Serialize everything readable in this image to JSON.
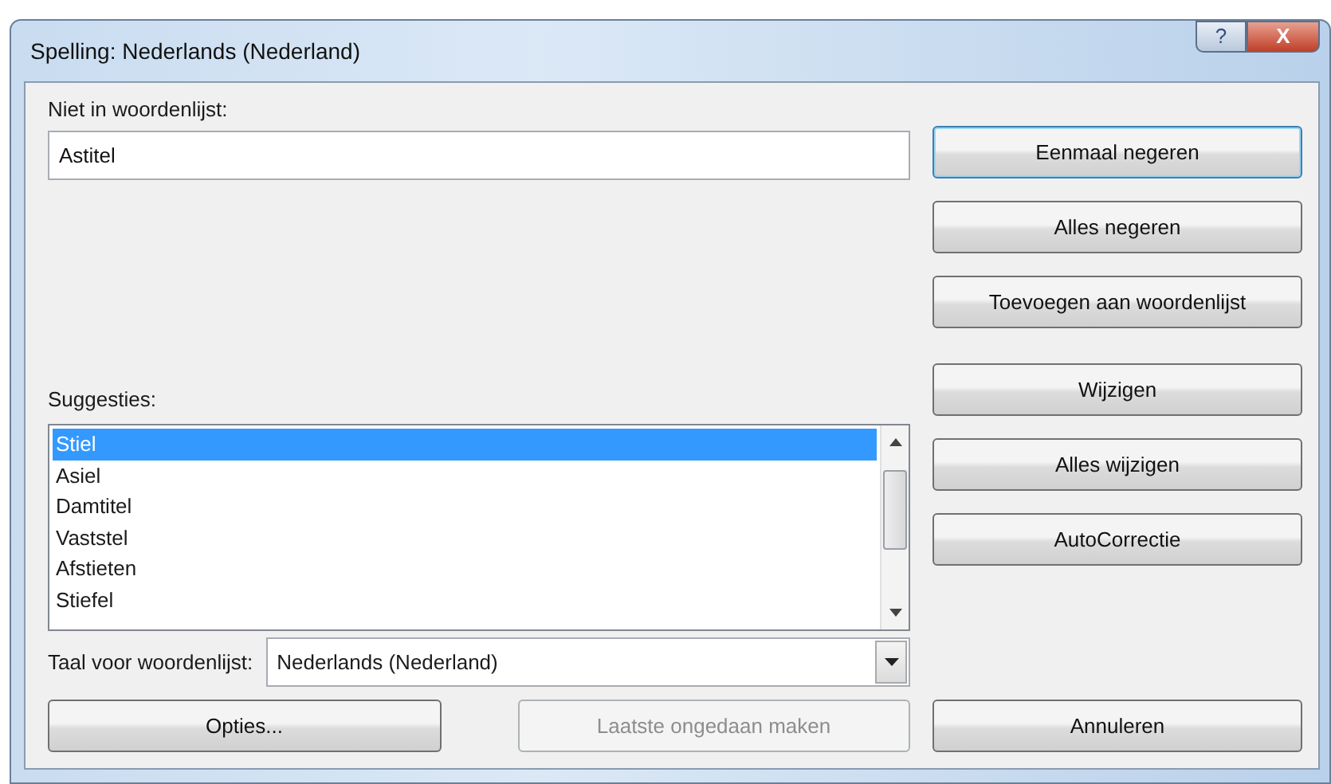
{
  "window": {
    "title": "Spelling: Nederlands (Nederland)",
    "controls": [
      {
        "kind": "help",
        "label": "?"
      },
      {
        "kind": "close",
        "label": "X"
      }
    ]
  },
  "not_in_dictionary": {
    "label": "Niet in woordenlijst:",
    "value": "Astitel"
  },
  "suggestions": {
    "label": "Suggesties:",
    "items": [
      {
        "text": "Stiel",
        "selected": true
      },
      {
        "text": "Asiel",
        "selected": false
      },
      {
        "text": "Damtitel",
        "selected": false
      },
      {
        "text": "Vaststel",
        "selected": false
      },
      {
        "text": "Afstieten",
        "selected": false
      },
      {
        "text": "Stiefel",
        "selected": false
      }
    ]
  },
  "dictionary_language": {
    "label": "Taal voor woordenlijst:",
    "value": "Nederlands (Nederland)"
  },
  "bottom_buttons": [
    {
      "label": "Opties...",
      "disabled": false
    },
    {
      "label": "Laatste ongedaan maken",
      "disabled": true
    }
  ],
  "side_button_groups": [
    [
      {
        "label": "Eenmaal negeren",
        "default": true
      },
      {
        "label": "Alles negeren",
        "default": false
      },
      {
        "label": "Toevoegen aan woordenlijst",
        "default": false
      }
    ],
    [
      {
        "label": "Wijzigen",
        "default": false
      },
      {
        "label": "Alles wijzigen",
        "default": false
      },
      {
        "label": "AutoCorrectie",
        "default": false
      }
    ],
    [
      {
        "label": "Annuleren",
        "default": false
      }
    ]
  ]
}
